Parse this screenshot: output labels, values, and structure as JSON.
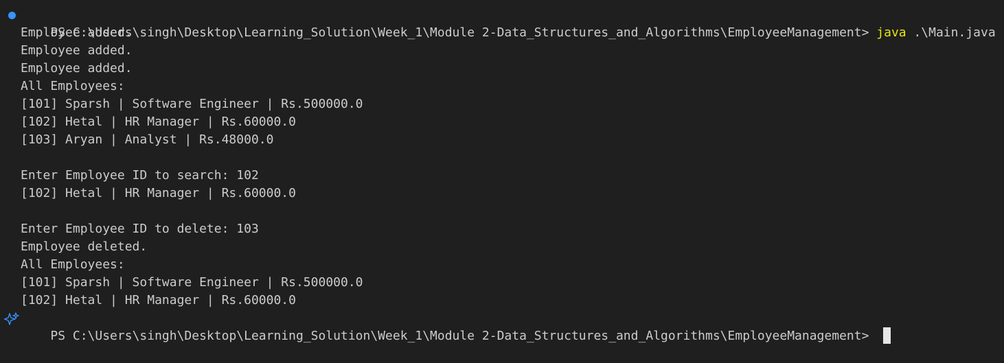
{
  "terminal": {
    "first_prompt": {
      "prompt": "PS C:\\Users\\singh\\Desktop\\Learning_Solution\\Week_1\\Module 2-Data_Structures_and_Algorithms\\EmployeeManagement> ",
      "command_exe": "java",
      "command_args": " .\\Main.java"
    },
    "output_lines": [
      "Employee added.",
      "Employee added.",
      "Employee added.",
      "All Employees:",
      "[101] Sparsh | Software Engineer | Rs.500000.0",
      "[102] Hetal | HR Manager | Rs.60000.0",
      "[103] Aryan | Analyst | Rs.48000.0",
      "",
      "Enter Employee ID to search: 102",
      "[102] Hetal | HR Manager | Rs.60000.0",
      "",
      "Enter Employee ID to delete: 103",
      "Employee deleted.",
      "All Employees:",
      "[101] Sparsh | Software Engineer | Rs.500000.0",
      "[102] Hetal | HR Manager | Rs.60000.0"
    ],
    "final_prompt": "PS C:\\Users\\singh\\Desktop\\Learning_Solution\\Week_1\\Module 2-Data_Structures_and_Algorithms\\EmployeeManagement> "
  },
  "icons": {
    "command_decoration": "circle-dot-icon",
    "prompt_decoration": "sparkle-icon"
  },
  "colors": {
    "background": "#1f1f1f",
    "foreground": "#cccccc",
    "command": "#e5e510",
    "decoration": "#3794ff",
    "cursor": "#e5e5e5"
  }
}
